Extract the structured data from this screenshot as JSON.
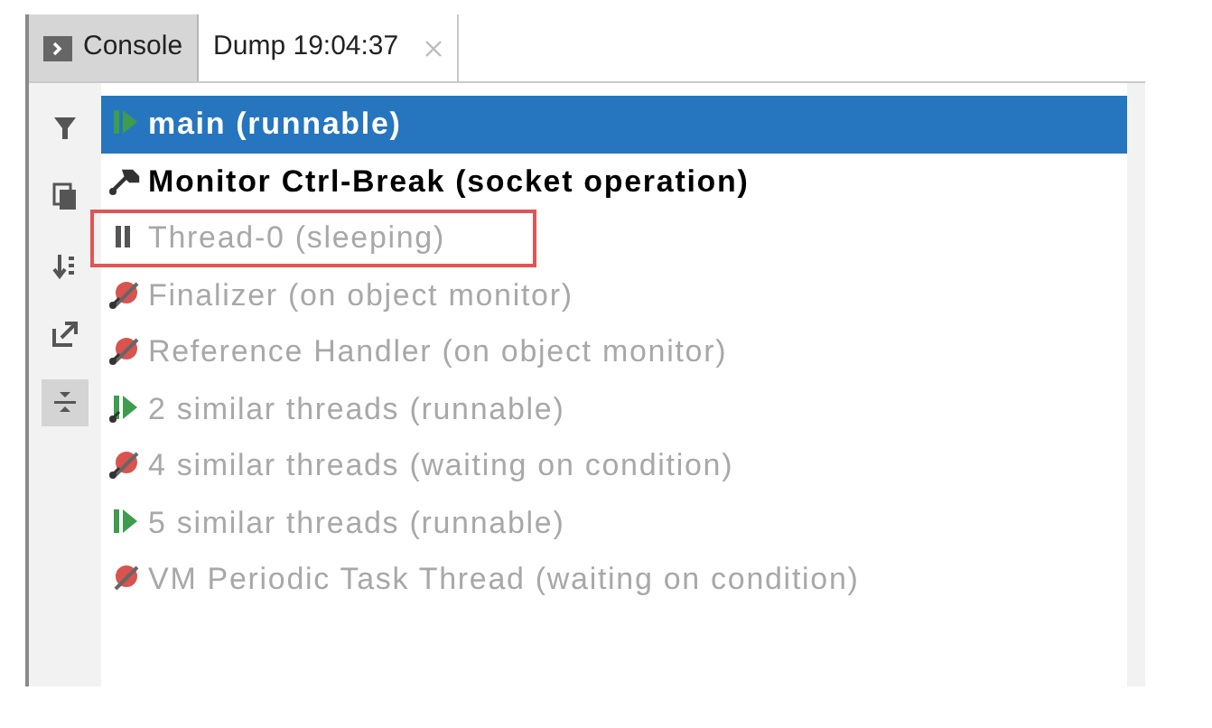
{
  "tabs": [
    {
      "label": "Console",
      "selected": false,
      "kind": "console"
    },
    {
      "label": "Dump 19:04:37",
      "selected": true,
      "kind": "dump"
    }
  ],
  "toolbar": [
    {
      "kind": "filter",
      "selected": false
    },
    {
      "kind": "copy",
      "selected": false
    },
    {
      "kind": "sort",
      "selected": false
    },
    {
      "kind": "export",
      "selected": false
    },
    {
      "kind": "collapse",
      "selected": true
    }
  ],
  "threads": [
    {
      "label": "main (runnable)",
      "kind": "runnable",
      "daemon": false,
      "active": true,
      "selected": true,
      "highlighted": false
    },
    {
      "label": "Monitor Ctrl-Break (socket operation)",
      "kind": "socket",
      "daemon": true,
      "active": true,
      "selected": false,
      "highlighted": false
    },
    {
      "label": "Thread-0 (sleeping)",
      "kind": "sleeping",
      "daemon": false,
      "active": false,
      "selected": false,
      "highlighted": true
    },
    {
      "label": "Finalizer (on object monitor)",
      "kind": "waiting",
      "daemon": true,
      "active": false,
      "selected": false,
      "highlighted": false
    },
    {
      "label": "Reference Handler (on object monitor)",
      "kind": "waiting",
      "daemon": true,
      "active": false,
      "selected": false,
      "highlighted": false
    },
    {
      "label": "2 similar threads (runnable)",
      "kind": "runnable",
      "daemon": true,
      "active": false,
      "selected": false,
      "highlighted": false
    },
    {
      "label": "4 similar threads (waiting on condition)",
      "kind": "waiting",
      "daemon": true,
      "active": false,
      "selected": false,
      "highlighted": false
    },
    {
      "label": "5 similar threads (runnable)",
      "kind": "runnable",
      "daemon": false,
      "active": false,
      "selected": false,
      "highlighted": false
    },
    {
      "label": "VM Periodic Task Thread (waiting on condition)",
      "kind": "waiting",
      "daemon": false,
      "active": false,
      "selected": false,
      "highlighted": false
    }
  ]
}
